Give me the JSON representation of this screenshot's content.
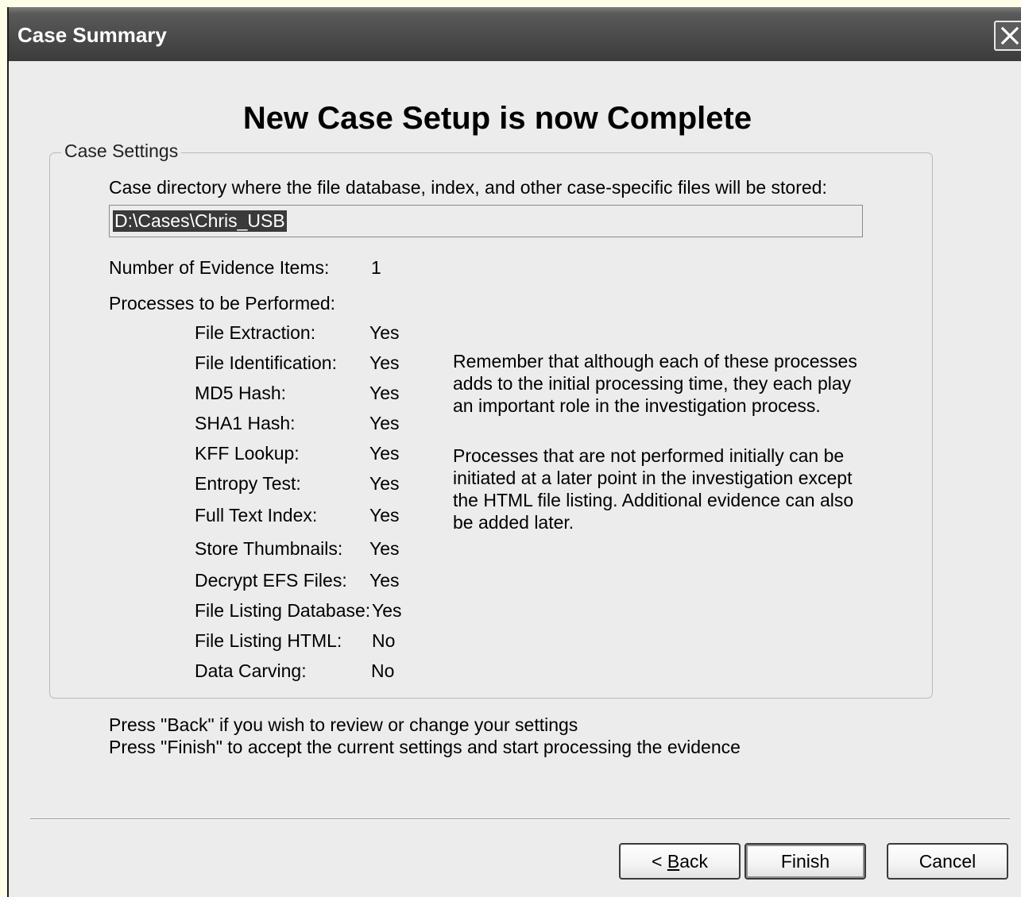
{
  "window": {
    "title": "Case Summary"
  },
  "heading": "New Case Setup is now Complete",
  "case_settings": {
    "legend": "Case Settings",
    "directory_label": "Case directory where the file database, index, and other case-specific files will be stored:",
    "directory_value": "D:\\Cases\\Chris_USB",
    "evidence_label": "Number of Evidence Items:",
    "evidence_value": "1",
    "processes_label": "Processes to be Performed:",
    "processes": [
      {
        "label": "File Extraction:",
        "value": "Yes"
      },
      {
        "label": "File Identification:",
        "value": "Yes"
      },
      {
        "label": "MD5 Hash:",
        "value": "Yes"
      },
      {
        "label": "SHA1 Hash:",
        "value": "Yes"
      },
      {
        "label": "KFF Lookup:",
        "value": "Yes"
      },
      {
        "label": "Entropy Test:",
        "value": "Yes"
      },
      {
        "label": "Full Text Index:",
        "value": "Yes"
      },
      {
        "label": "Store Thumbnails:",
        "value": "Yes"
      },
      {
        "label": "Decrypt EFS Files:",
        "value": "Yes"
      },
      {
        "label": "File Listing Database:",
        "value": "Yes"
      },
      {
        "label": "File Listing HTML:",
        "value": "No"
      },
      {
        "label": "Data Carving:",
        "value": "No"
      }
    ],
    "note1": "Remember that although each of these processes adds to the initial processing time, they each play an important role in the investigation process.",
    "note2": "Processes that are not performed initially can be initiated at a later point in the investigation except the HTML file listing. Additional evidence can also be added later."
  },
  "instructions": {
    "back": "Press \"Back\" if you wish to review or change your settings",
    "finish": "Press \"Finish\" to accept the current settings and start processing the evidence"
  },
  "buttons": {
    "back_prefix": "< ",
    "back_mnemonic": "B",
    "back_rest": "ack",
    "finish": "Finish",
    "cancel": "Cancel"
  },
  "colors": {
    "titlebar": "#4a4a4a",
    "dialog_bg": "#ececec",
    "selection": "#3a3a3a"
  }
}
